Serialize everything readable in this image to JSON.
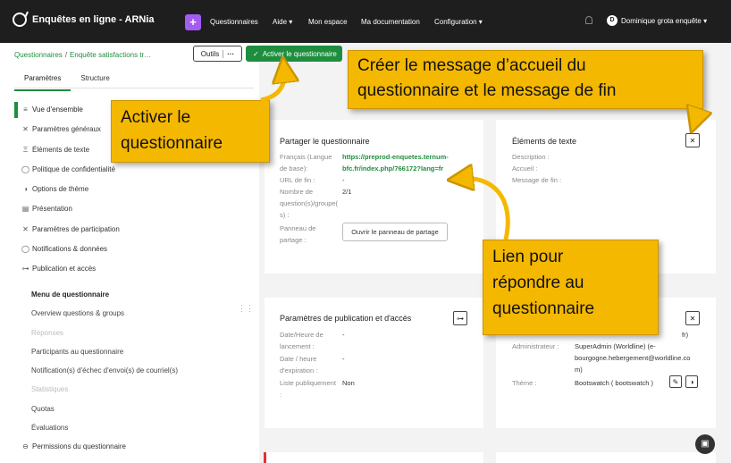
{
  "app": {
    "title": "Enquêtes en ligne - ARNia",
    "add_label": "+"
  },
  "nav": {
    "questionnaires": "Questionnaires",
    "aide": "Aide ▾",
    "espace": "Mon espace",
    "documentation": "Ma documentation",
    "configuration": "Configuration ▾"
  },
  "user": {
    "initial": "D",
    "name": "Dominique grota enquête ▾"
  },
  "breadcrumb": {
    "root": "Questionnaires",
    "separator": "/",
    "current": "Enquête satisfactions tr…"
  },
  "toolbar": {
    "tools_label": "Outils",
    "more_label": "···",
    "activate_label": "Activer le questionnaire"
  },
  "tabs": [
    "Paramètres",
    "Structure"
  ],
  "menu": [
    {
      "icon": "≡",
      "label": "Vue d'ensemble"
    },
    {
      "icon": "✕",
      "label": "Paramètres généraux"
    },
    {
      "icon": "Ξ",
      "label": "Éléments de texte"
    },
    {
      "icon": "◯",
      "label": "Politique de confidentialité"
    },
    {
      "icon": "◑",
      "label": "Options de thème"
    },
    {
      "icon": "▤",
      "label": "Présentation"
    },
    {
      "icon": "✕",
      "label": "Paramètres de participation"
    },
    {
      "icon": "◯",
      "label": "Notifications & données"
    },
    {
      "icon": "⊶",
      "label": "Publication et accès"
    }
  ],
  "submenu": {
    "heading": "Menu de questionnaire",
    "items": [
      {
        "label": "Overview questions & groups",
        "enabled": true
      },
      {
        "label": "Réponses",
        "enabled": false
      },
      {
        "label": "Participants au questionnaire",
        "enabled": true
      },
      {
        "label": "Notification(s) d'échec d'envoi(s) de courriel(s)",
        "enabled": true
      },
      {
        "label": "Statistiques",
        "enabled": false
      },
      {
        "label": "Quotas",
        "enabled": true
      },
      {
        "label": "Évaluations",
        "enabled": true
      }
    ],
    "permissions": {
      "icon": "⊖",
      "label": "Permissions du questionnaire"
    }
  },
  "share_card": {
    "title": "Partager le questionnaire",
    "lang_label_1": "Français (Langue",
    "lang_label_2": "de base):",
    "url_line_1": "https://preprod-enquetes.ternum-",
    "url_line_2": "bfc.fr/index.php/766172?lang=fr",
    "end_url_label": "URL de fin :",
    "end_url_value": "-",
    "count_label_1": "Nombre de",
    "count_label_2": "question(s)/groupe(",
    "count_label_3": "s) :",
    "count_value": "2/1",
    "panel_label_1": "Panneau de",
    "panel_label_2": "partage :",
    "panel_button": "Ouvrir le panneau de partage"
  },
  "text_card": {
    "title": "Éléments de texte",
    "description_label": "Description :",
    "welcome_label": "Accueil :",
    "end_message_label": "Message de fin :"
  },
  "publication_card": {
    "title": "Paramètres de publication et d'accès",
    "start_label_1": "Date/Heure de",
    "start_label_2": "lancement :",
    "start_value": "-",
    "expiry_label_1": "Date / heure",
    "expiry_label_2": "d'expiration :",
    "expiry_value": "-",
    "public_label_1": "Liste publiquement",
    "public_label_2": ":",
    "public_value": "Non"
  },
  "survey_card": {
    "partial_value": "fr)",
    "admin_label": "Administrateur :",
    "admin_value_1": "SuperAdmin (Worldline) (e-",
    "admin_value_2": "bourgogne.hebergement@worldline.co",
    "admin_value_3": "m)",
    "theme_label": "Thème :",
    "theme_value": "Bootswatch ( bootswatch )"
  },
  "callouts": {
    "activate": [
      "Activer le",
      "questionnaire"
    ],
    "messages": [
      "Créer le message d’accueil du",
      "questionnaire et le message de fin"
    ],
    "link": [
      "Lien pour",
      "répondre au",
      "questionnaire"
    ]
  },
  "colors": {
    "brand_green": "#1e8e3e",
    "topbar": "#1e1e1e",
    "callout": "#f5b800",
    "add_button": "#a35cf0"
  }
}
